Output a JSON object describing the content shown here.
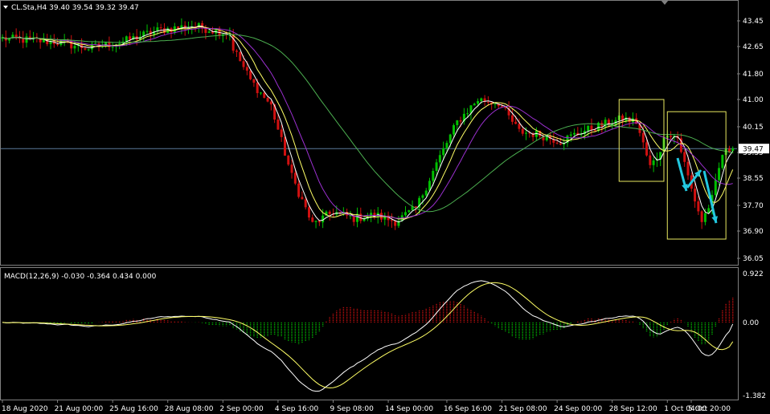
{
  "header": {
    "main": "CL.Sta,H4  39.40 39.54 39.32 39.47",
    "macd": "MACD(12,26,9) -0.030 -0.364 0.434 0.000"
  },
  "colors": {
    "background": "#000000",
    "bull": "#00c000",
    "bear": "#d01010",
    "ma_fast": "#ffffff",
    "ma_yellow": "#ffff66",
    "ma_purple": "#9b30d0",
    "ma_green": "#4caf50",
    "macd_line": "#ffffff",
    "signal_line": "#ffff66",
    "current_price_line": "#5a7a9a",
    "forecast_arrow": "#22c8e0",
    "highlight_box": "#e8e860"
  },
  "chart_data": [
    {
      "type": "candlestick",
      "symbol": "CL.Sta",
      "timeframe": "H4",
      "last_ohlc": {
        "open": 39.4,
        "high": 39.54,
        "low": 39.32,
        "close": 39.47
      },
      "current_price_label": "39.47",
      "y_ticks": [
        "43.45",
        "42.65",
        "41.80",
        "41.00",
        "40.15",
        "39.35",
        "38.55",
        "37.70",
        "36.90",
        "36.05"
      ],
      "ylim": [
        35.9,
        44.0
      ],
      "x_labels": [
        "18 Aug 2020",
        "21 Aug 00:00",
        "25 Aug 16:00",
        "28 Aug 08:00",
        "2 Sep 00:00",
        "4 Sep 16:00",
        "9 Sep 08:00",
        "14 Sep 00:00",
        "16 Sep 16:00",
        "21 Sep 08:00",
        "24 Sep 00:00",
        "28 Sep 12:00",
        "1 Oct 04:00",
        "5 Oct 20:00"
      ],
      "price_path_keypoints": [
        [
          0,
          42.9
        ],
        [
          15,
          42.8
        ],
        [
          25,
          42.6
        ],
        [
          35,
          42.8
        ],
        [
          45,
          43.15
        ],
        [
          55,
          43.3
        ],
        [
          66,
          43.05
        ],
        [
          67,
          42.6
        ],
        [
          72,
          41.6
        ],
        [
          78,
          40.8
        ],
        [
          84,
          38.6
        ],
        [
          90,
          37.1
        ],
        [
          96,
          37.5
        ],
        [
          102,
          37.3
        ],
        [
          108,
          37.4
        ],
        [
          114,
          37.2
        ],
        [
          120,
          37.6
        ],
        [
          126,
          39.0
        ],
        [
          132,
          40.3
        ],
        [
          138,
          41.0
        ],
        [
          144,
          40.9
        ],
        [
          150,
          40.0
        ],
        [
          156,
          39.9
        ],
        [
          162,
          39.7
        ],
        [
          168,
          40.0
        ],
        [
          174,
          40.2
        ],
        [
          180,
          40.4
        ],
        [
          184,
          40.3
        ],
        [
          188,
          38.9
        ],
        [
          190,
          39.2
        ],
        [
          193,
          40.0
        ],
        [
          196,
          39.8
        ],
        [
          200,
          38.2
        ],
        [
          203,
          37.2
        ],
        [
          206,
          37.9
        ],
        [
          209,
          39.3
        ],
        [
          212,
          39.47
        ]
      ],
      "moving_averages": [
        {
          "color": "white"
        },
        {
          "color": "yellow"
        },
        {
          "color": "purple"
        },
        {
          "color": "green"
        }
      ],
      "annotations": [
        "highlight box 28 Sep – 30 Sep",
        "highlight box 1 Oct – 5 Oct",
        "forecast arrows: down, up, down"
      ]
    },
    {
      "type": "macd",
      "params": "12,26,9",
      "values": {
        "macd": -0.03,
        "signal": -0.364,
        "histogram": 0.434,
        "zero": 0.0
      },
      "y_ticks": [
        "0.922",
        "0.00",
        "-1.382"
      ],
      "ylim": [
        -1.382,
        0.922
      ]
    }
  ]
}
